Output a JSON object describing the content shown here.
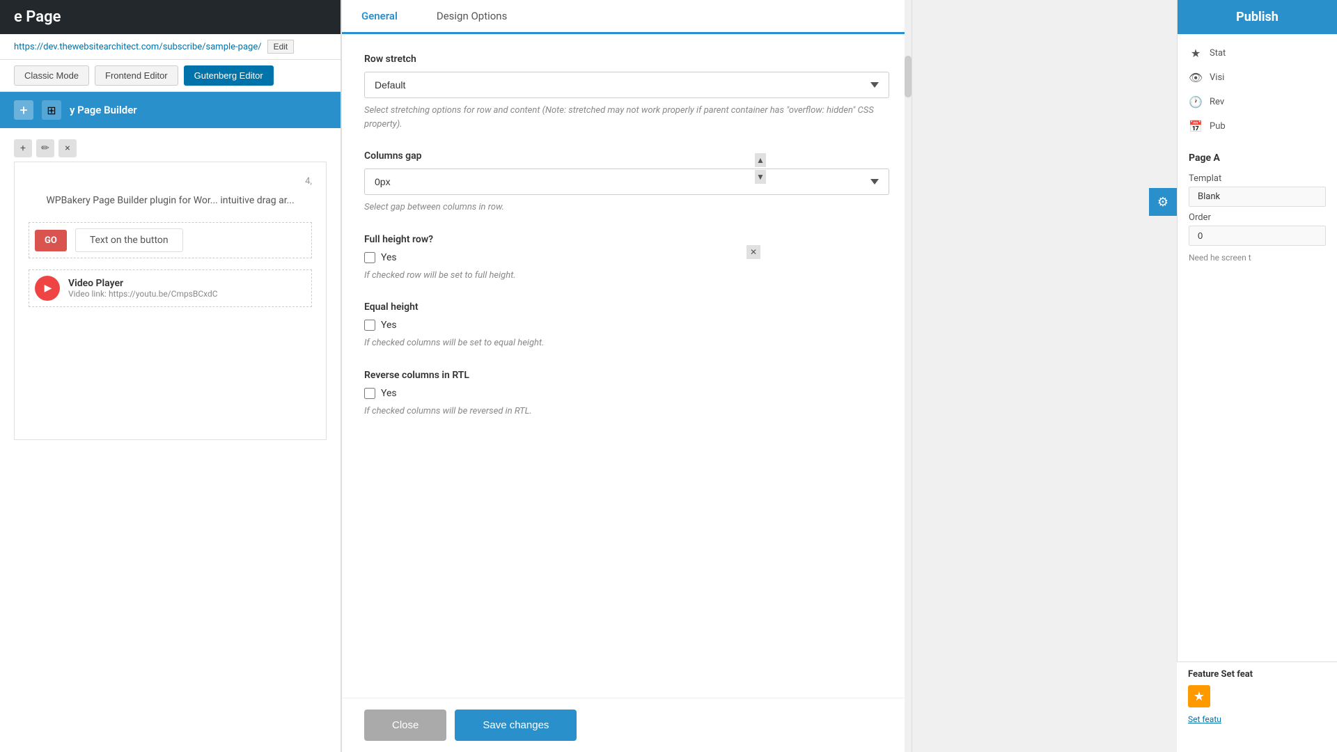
{
  "page": {
    "title": "e Page",
    "url": "https://dev.thewebsitearchitect.com/subscribe/sample-page/",
    "edit_label": "Edit"
  },
  "editor_tabs": {
    "classic": "Classic Mode",
    "frontend": "Frontend Editor",
    "gutenberg": "Gutenberg Editor"
  },
  "builder": {
    "title": "y Page Builder"
  },
  "canvas": {
    "page_number": "4,",
    "plugin_text": "WPBakery Page Builder plugin for Wor... intuitive drag ar...",
    "button_go": "GO",
    "button_text_label": "Text on the button",
    "video_title": "Video Player",
    "video_link": "Video link: https://youtu.be/CmpsBCxdC"
  },
  "modal": {
    "tab_general": "General",
    "tab_design": "Design Options",
    "row_stretch_label": "Row stretch",
    "row_stretch_value": "Default",
    "row_stretch_hint": "Select stretching options for row and content (Note: stretched may not work properly if parent container has \"overflow: hidden\" CSS property).",
    "columns_gap_label": "Columns gap",
    "columns_gap_value": "0px",
    "columns_gap_hint": "Select gap between columns in row.",
    "full_height_label": "Full height row?",
    "full_height_checkbox": "Yes",
    "full_height_hint": "If checked row will be set to full height.",
    "equal_height_label": "Equal height",
    "equal_height_checkbox": "Yes",
    "equal_height_hint": "If checked columns will be set to equal height.",
    "reverse_rtl_label": "Reverse columns in RTL",
    "reverse_rtl_checkbox": "Yes",
    "reverse_rtl_hint": "If checked columns will be reversed in RTL.",
    "close_label": "Close",
    "save_label": "Save changes"
  },
  "right_sidebar": {
    "publish_label": "Publish",
    "status_label": "Stat",
    "visibility_label": "Visi",
    "revisions_label": "Rev",
    "publish2_label": "Pub",
    "section_title": "Page A",
    "template_label": "Templat",
    "template_value": "Blank",
    "order_label": "Order",
    "order_value": "0",
    "note_text": "Need he screen t",
    "feature_title": "Feature Set feat",
    "set_feature_label": "Set featu"
  },
  "icons": {
    "add": "+",
    "layout": "⊞",
    "edit": "✏",
    "delete": "×",
    "star": "★",
    "eye": "👁",
    "clock": "🕐",
    "calendar": "📅",
    "gear": "⚙",
    "move": "↕",
    "close_x": "✕",
    "scroll_up": "▲",
    "scroll_down": "▼",
    "chevron_down": "▾"
  }
}
